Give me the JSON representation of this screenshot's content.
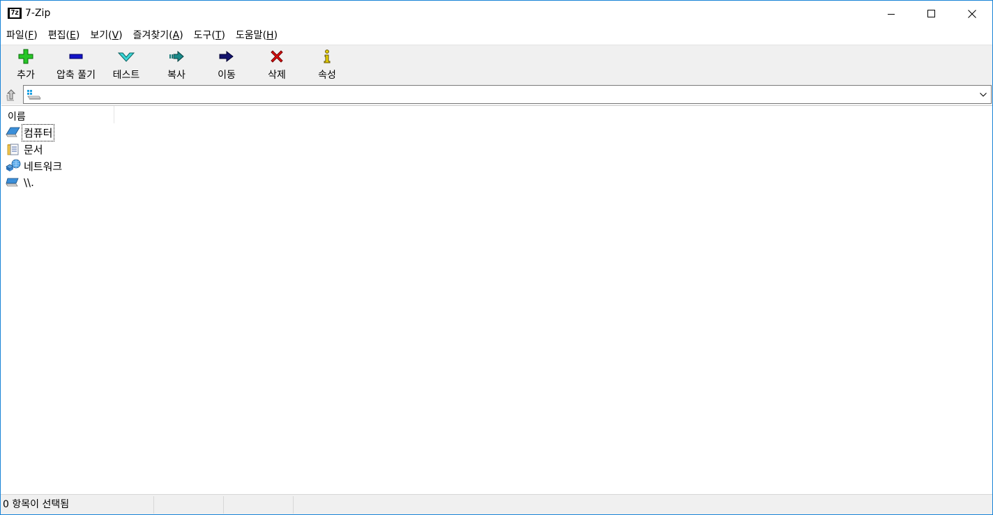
{
  "window": {
    "title": "7-Zip",
    "icon_text": "7z"
  },
  "menu": [
    {
      "label": "파일",
      "accel": "F"
    },
    {
      "label": "편집",
      "accel": "E"
    },
    {
      "label": "보기",
      "accel": "V"
    },
    {
      "label": "즐겨찾기",
      "accel": "A"
    },
    {
      "label": "도구",
      "accel": "T"
    },
    {
      "label": "도움말",
      "accel": "H"
    }
  ],
  "toolbar": {
    "add": "추가",
    "extract": "압축 풀기",
    "test": "테스트",
    "copy": "복사",
    "move": "이동",
    "delete": "삭제",
    "info": "속성"
  },
  "address": {
    "value": "",
    "icon": "windows-drive-icon"
  },
  "list": {
    "column_name": "이름",
    "items": [
      {
        "label": "컴퓨터",
        "icon": "computer-icon",
        "focused": true
      },
      {
        "label": "문서",
        "icon": "documents-icon",
        "focused": false
      },
      {
        "label": "네트워크",
        "icon": "network-icon",
        "focused": false
      },
      {
        "label": "\\\\.",
        "icon": "device-icon",
        "focused": false
      }
    ]
  },
  "status": {
    "selection": "0 항목이 선택됨",
    "cell2": "",
    "cell3": "",
    "cell4": ""
  },
  "colors": {
    "accent_border": "#1883d7",
    "toolbar_bg": "#f0f0f0"
  }
}
